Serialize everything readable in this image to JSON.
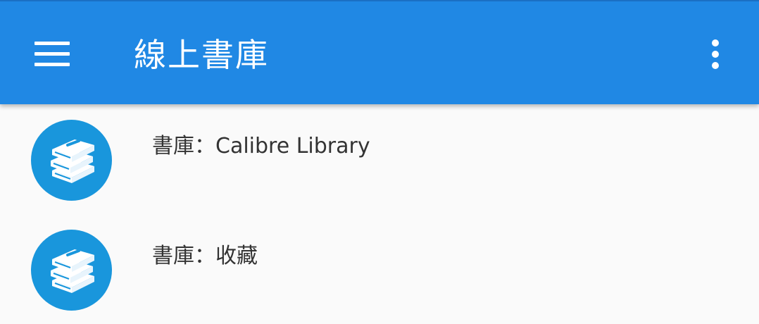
{
  "app_bar": {
    "title": "線上書庫",
    "menu_icon": "hamburger-menu-icon",
    "overflow_icon": "more-vert-icon",
    "color": "#2088e4"
  },
  "libraries": [
    {
      "label": "書庫：Calibre Library",
      "icon": "books-icon"
    },
    {
      "label": "書庫：收藏",
      "icon": "books-icon"
    }
  ],
  "colors": {
    "avatar": "#1996dc",
    "background": "#fafafa",
    "text": "#333333"
  }
}
